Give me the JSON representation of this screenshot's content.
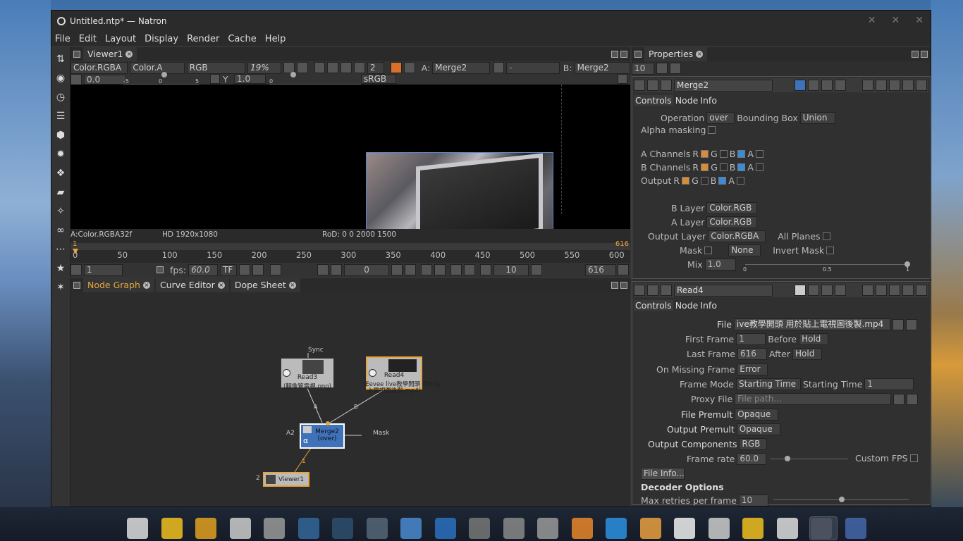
{
  "window": {
    "title": "Untitled.ntp* — Natron"
  },
  "menu": [
    "File",
    "Edit",
    "Layout",
    "Display",
    "Render",
    "Cache",
    "Help"
  ],
  "viewer": {
    "tab": "Viewer1",
    "layer": "Color.RGBA",
    "alpha": "Color.A",
    "channels": "RGB",
    "zoom": "19%",
    "proxy": "2",
    "a_input_label": "A:",
    "a_input": "Merge2",
    "b_input_label": "B:",
    "b_input": "Merge2",
    "gain": "0.0",
    "gamma_label": "Y",
    "gamma": "1.0",
    "colorspace": "sRGB",
    "ruler_ticks": [
      "-5",
      "0",
      "5"
    ],
    "ruler2_tick": "0",
    "overlay_hd": "HD",
    "status_left": "A:Color.RGBA32f",
    "status_format": "HD 1920x1080",
    "status_rod": "RoD: 0 0 2000 1500"
  },
  "timeline": {
    "start": "1",
    "end_marker": "616",
    "ticks": [
      "0",
      "50",
      "100",
      "150",
      "200",
      "250",
      "300",
      "350",
      "400",
      "450",
      "500",
      "550",
      "600"
    ],
    "in_frame": "1",
    "fps_label": "fps:",
    "fps": "60.0",
    "tf": "TF",
    "current": "0",
    "step": "10",
    "out_frame": "616"
  },
  "graph": {
    "tabs": [
      "Node Graph",
      "Curve Editor",
      "Dope Sheet"
    ],
    "nodes": {
      "read3": {
        "name": "Read3",
        "sub": "(翻像管電視.png)",
        "sync": "Sync"
      },
      "read4": {
        "name": "Read4",
        "sub1": "(Eevee live教學開頭 用於貼",
        "sub2": "上電視圖後製.mp4)"
      },
      "merge2": {
        "name": "Merge2",
        "sub": "(over)",
        "alpha": "α",
        "a2": "A2",
        "mask": "Mask",
        "a": "A",
        "b": "B"
      },
      "viewer1": {
        "name": "Viewer1",
        "input": "2",
        "link": "1"
      }
    }
  },
  "properties": {
    "tab": "Properties",
    "max_panels": "10",
    "merge": {
      "name": "Merge2",
      "tabs": [
        "Controls",
        "Node",
        "Info"
      ],
      "operation_label": "Operation",
      "operation": "over",
      "bbox_label": "Bounding Box",
      "bbox": "Union",
      "alpha_masking": "Alpha masking",
      "a_channels": "A Channels",
      "b_channels": "B Channels",
      "output": "Output",
      "ch_r": "R",
      "ch_g": "G",
      "ch_b": "B",
      "ch_a": "A",
      "b_layer_label": "B Layer",
      "b_layer": "Color.RGB",
      "a_layer_label": "A Layer",
      "a_layer": "Color.RGB",
      "out_layer_label": "Output Layer",
      "out_layer": "Color.RGBA",
      "all_planes": "All Planes",
      "mask_label": "Mask",
      "mask_value": "None",
      "invert_mask": "Invert Mask",
      "mix_label": "Mix",
      "mix": "1.0",
      "mix_ticks": [
        "0",
        "0.5",
        "1"
      ]
    },
    "read": {
      "name": "Read4",
      "tabs": [
        "Controls",
        "Node",
        "Info"
      ],
      "file_label": "File",
      "file": "ive教學開頭 用於貼上電視圖後製.mp4",
      "first_frame_label": "First Frame",
      "first_frame": "1",
      "before_label": "Before",
      "before": "Hold",
      "last_frame_label": "Last Frame",
      "last_frame": "616",
      "after_label": "After",
      "after": "Hold",
      "missing_label": "On Missing Frame",
      "missing": "Error",
      "frame_mode_label": "Frame Mode",
      "frame_mode": "Starting Time",
      "starting_time_label": "Starting Time",
      "starting_time": "1",
      "proxy_label": "Proxy File",
      "proxy_placeholder": "File path...",
      "file_premult_label": "File Premult",
      "file_premult": "Opaque",
      "output_premult_label": "Output Premult",
      "output_premult": "Opaque",
      "components_label": "Output Components",
      "components": "RGB",
      "framerate_label": "Frame rate",
      "framerate": "60.0",
      "custom_fps": "Custom FPS",
      "file_info": "File Info...",
      "decoder_options": "Decoder Options",
      "retries_label": "Max retries per frame",
      "retries": "10",
      "retries_ticks": [
        "0",
        "5",
        "10",
        "15",
        "20"
      ]
    }
  },
  "taskbar_icons": [
    "trash-icon",
    "files-icon",
    "chrome-icon",
    "disc-icon",
    "chat-icon",
    "steam-icon",
    "gpu-icon",
    "layers-icon",
    "inkscape-icon",
    "thunderbird-icon",
    "dropbox-icon",
    "gimp-icon",
    "film-icon",
    "blender-icon",
    "audio-icon",
    "headphones-icon",
    "piano-icon",
    "calculator-icon",
    "notes-icon",
    "finance-icon",
    "tool-icon",
    "window-icon",
    "natron-icon"
  ]
}
